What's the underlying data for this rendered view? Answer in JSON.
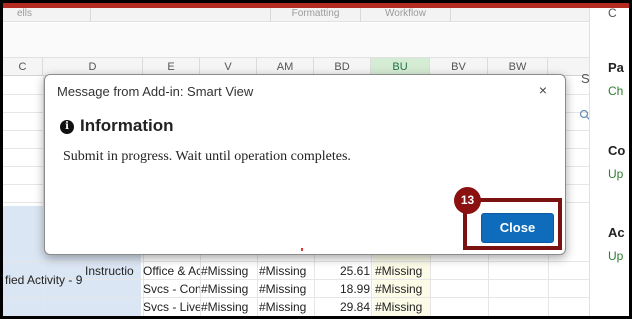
{
  "ribbon": {
    "groups": [
      "ells",
      "Formatting",
      "Workflow"
    ]
  },
  "columns": [
    "C",
    "D",
    "E",
    "V",
    "AM",
    "BD",
    "BU",
    "BV",
    "BW"
  ],
  "selected_column": "BU",
  "rows": [
    {
      "a": "fied Activity - 9",
      "d": "Instructio",
      "e": "Office & Ac",
      "v": "#Missing",
      "am": "#Missing",
      "bd": "25.61",
      "bu": "#Missing"
    },
    {
      "a": "",
      "d": "",
      "e": "Svcs - Con",
      "v": "#Missing",
      "am": "#Missing",
      "bd": "18.99",
      "bu": "#Missing"
    },
    {
      "a": "",
      "d": "",
      "e": "Svcs - Live",
      "v": "#Missing",
      "am": "#Missing",
      "bd": "29.84",
      "bu": "#Missing"
    }
  ],
  "task_pane": {
    "title_fragment": "Sr"
  },
  "right_pane": {
    "top_fragment": "C",
    "items": [
      {
        "head": "Pa",
        "sub": "Ch"
      },
      {
        "head": "Co",
        "sub": "Up"
      },
      {
        "head": "Ac",
        "sub": "Up"
      }
    ]
  },
  "dialog": {
    "title": "Message from Add-in: Smart View",
    "close_glyph": "×",
    "info_glyph": "i",
    "heading": "Information",
    "message": "Submit in progress. Wait until operation completes.",
    "button_label": "Close"
  },
  "callout": {
    "step_number": "13"
  },
  "colors": {
    "accent_button": "#0f6cbd",
    "highlight": "#7a1212",
    "selected_column": "#d5ecd4"
  }
}
